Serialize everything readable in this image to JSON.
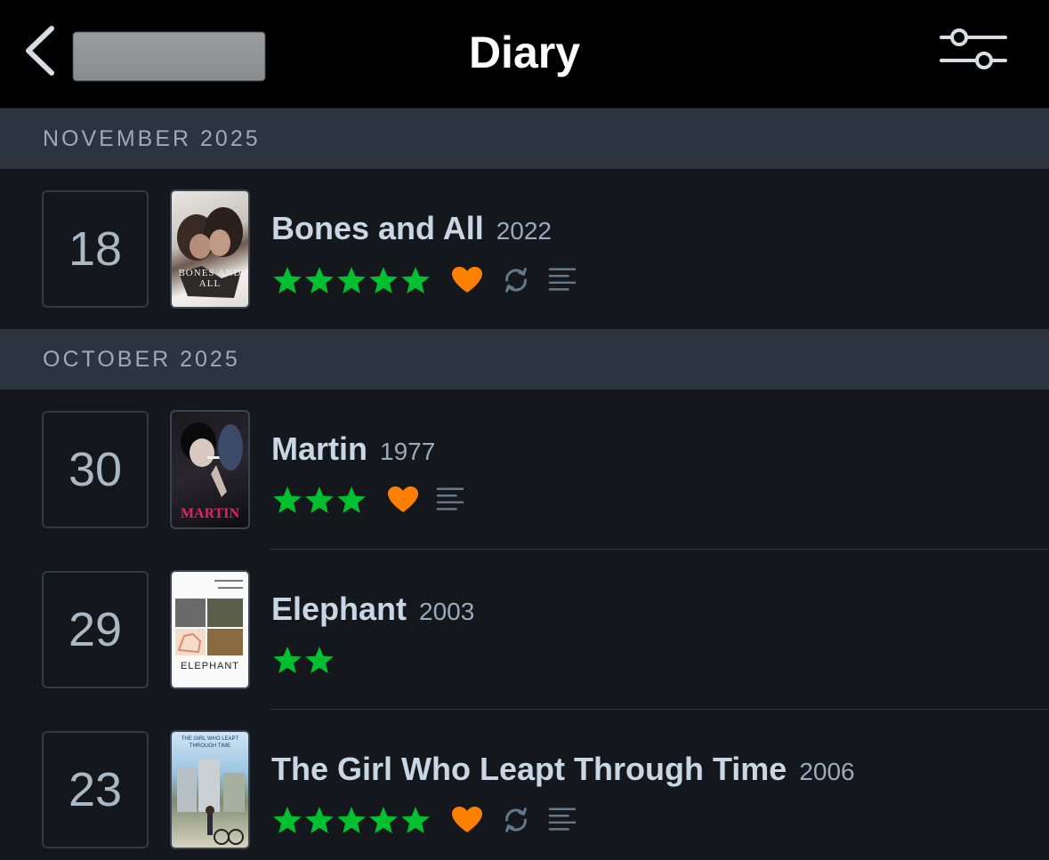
{
  "header": {
    "title": "Diary"
  },
  "sections": [
    {
      "label": "NOVEMBER 2025"
    },
    {
      "label": "OCTOBER 2025"
    }
  ],
  "entries": [
    {
      "day": "18",
      "title": "Bones and All",
      "year": "2022",
      "rating": 5,
      "liked": true,
      "rewatch": true,
      "review": true,
      "poster_text": "BONES AND ALL"
    },
    {
      "day": "30",
      "title": "Martin",
      "year": "1977",
      "rating": 3,
      "liked": true,
      "rewatch": false,
      "review": true,
      "poster_text": "MARTIN"
    },
    {
      "day": "29",
      "title": "Elephant",
      "year": "2003",
      "rating": 2,
      "liked": false,
      "rewatch": false,
      "review": false,
      "poster_text": "ELEPHANT"
    },
    {
      "day": "23",
      "title": "The Girl Who Leapt Through Time",
      "year": "2006",
      "rating": 5,
      "liked": true,
      "rewatch": true,
      "review": true,
      "poster_text": "THE GIRL WHO LEAPT THROUGH TIME"
    }
  ],
  "colors": {
    "star": "#00c030",
    "heart": "#ff8000",
    "muted_icon": "#667788",
    "section_bg": "#2c3440",
    "page_bg": "#14181c"
  },
  "icons": {
    "back": "chevron-left-icon",
    "filter": "sliders-icon",
    "rating": "star-icon",
    "like": "heart-icon",
    "rewatch": "rewatch-icon",
    "review": "review-lines-icon"
  }
}
